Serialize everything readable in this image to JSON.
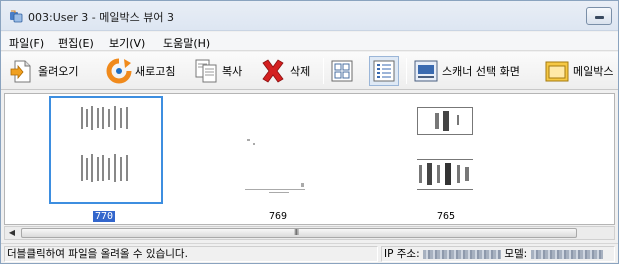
{
  "window": {
    "title": "003:User 3 - 메일박스 뷰어 3"
  },
  "menu": {
    "items": [
      {
        "label": "파일(F)"
      },
      {
        "label": "편집(E)"
      },
      {
        "label": "보기(V)"
      },
      {
        "label": "도움말(H)"
      }
    ]
  },
  "toolbar": {
    "open_label": "올려오기",
    "refresh_label": "새로고침",
    "copy_label": "복사",
    "delete_label": "삭제",
    "scanner_label": "스캐너 선택 화면",
    "mailbox_label": "메일박스"
  },
  "thumbnails": [
    {
      "label": "770",
      "selected": true
    },
    {
      "label": "769",
      "selected": false
    },
    {
      "label": "765",
      "selected": false
    }
  ],
  "scrollbar": {
    "grip": "III"
  },
  "status": {
    "hint": "더블클릭하여 파일을 올려올 수 있습니다.",
    "ip_label": "IP 주소:",
    "model_label": "모델:"
  },
  "colors": {
    "selection": "#3d8ee0",
    "label_highlight": "#3366cc",
    "delete_red": "#d42020",
    "refresh_orange": "#f08a1c"
  }
}
